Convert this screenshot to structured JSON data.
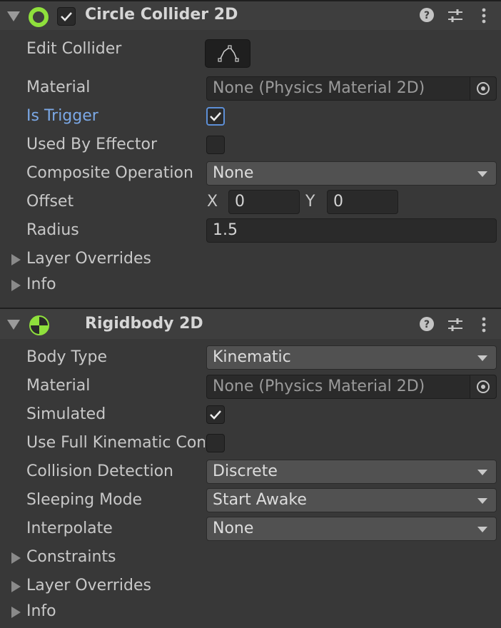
{
  "circle_collider": {
    "title": "Circle Collider 2D",
    "enabled": true,
    "edit_collider_label": "Edit Collider",
    "material_label": "Material",
    "material_value": "None (Physics Material 2D)",
    "is_trigger_label": "Is Trigger",
    "is_trigger": true,
    "used_by_effector_label": "Used By Effector",
    "used_by_effector": false,
    "composite_operation_label": "Composite Operation",
    "composite_operation_value": "None",
    "offset_label": "Offset",
    "offset_x_label": "X",
    "offset_x": "0",
    "offset_y_label": "Y",
    "offset_y": "0",
    "radius_label": "Radius",
    "radius_value": "1.5",
    "layer_overrides_label": "Layer Overrides",
    "info_label": "Info"
  },
  "rigidbody": {
    "title": "Rigidbody 2D",
    "body_type_label": "Body Type",
    "body_type_value": "Kinematic",
    "material_label": "Material",
    "material_value": "None (Physics Material 2D)",
    "simulated_label": "Simulated",
    "simulated": true,
    "full_kinematic_label": "Use Full Kinematic Contacts",
    "full_kinematic": false,
    "collision_detection_label": "Collision Detection",
    "collision_detection_value": "Discrete",
    "sleeping_mode_label": "Sleeping Mode",
    "sleeping_mode_value": "Start Awake",
    "interpolate_label": "Interpolate",
    "interpolate_value": "None",
    "constraints_label": "Constraints",
    "layer_overrides_label": "Layer Overrides",
    "info_label": "Info"
  },
  "colors": {
    "accent": "#5d8fd6",
    "component_icon": "#8fe03c"
  }
}
